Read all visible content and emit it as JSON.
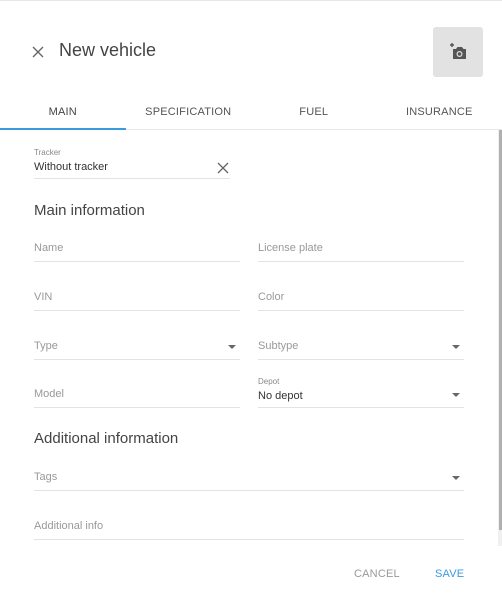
{
  "header": {
    "title": "New vehicle",
    "close_icon": "close-icon",
    "photo_icon": "add-photo-camera-icon"
  },
  "tabs": [
    {
      "label": "MAIN",
      "active": true
    },
    {
      "label": "SPECIFICATION",
      "active": false
    },
    {
      "label": "FUEL",
      "active": false
    },
    {
      "label": "INSURANCE",
      "active": false
    }
  ],
  "tracker": {
    "label": "Tracker",
    "value": "Without tracker",
    "clear_icon": "clear-icon"
  },
  "main_info": {
    "title": "Main information",
    "name": {
      "placeholder": "Name"
    },
    "license_plate": {
      "placeholder": "License plate"
    },
    "vin": {
      "placeholder": "VIN"
    },
    "color": {
      "placeholder": "Color"
    },
    "type": {
      "placeholder": "Type"
    },
    "subtype": {
      "placeholder": "Subtype"
    },
    "model": {
      "placeholder": "Model"
    },
    "depot": {
      "label": "Depot",
      "value": "No depot"
    }
  },
  "additional_info": {
    "title": "Additional information",
    "tags": {
      "placeholder": "Tags"
    },
    "info": {
      "placeholder": "Additional info"
    }
  },
  "footer": {
    "cancel_label": "CANCEL",
    "save_label": "SAVE"
  },
  "colors": {
    "accent": "#3a9be0",
    "photo_button_bg": "#e2e2e2"
  }
}
